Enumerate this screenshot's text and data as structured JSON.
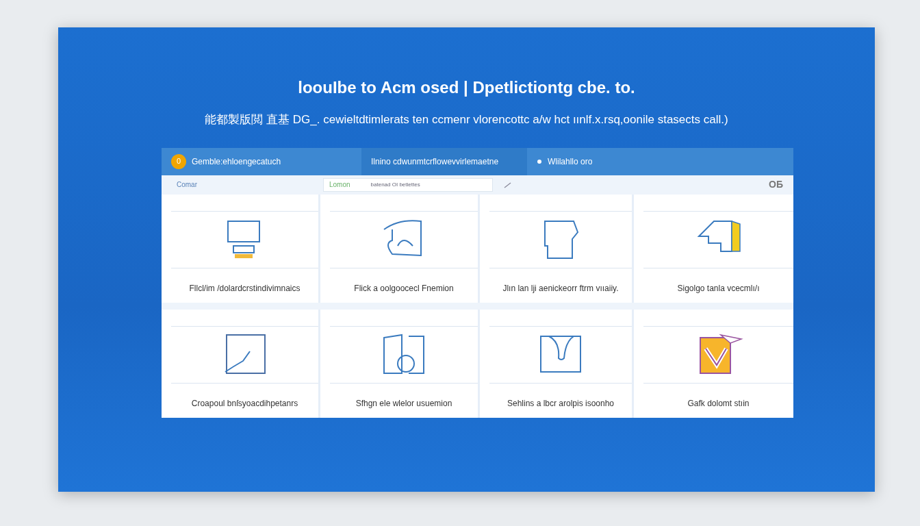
{
  "title": "loouIbe to  Acm osed  | Dpetlictiontg cbe. to.",
  "subtitle": "能都製版閲 直基  DG_. cewieltdtimlerats ten ccmenr vlorencottc a/w hct ıınlf.x.rsq,oonile stasects call.)",
  "header": {
    "badge": "0",
    "segments": [
      {
        "label": "Gemble:ehloengecatuch"
      },
      {
        "label": "Ilnino cdwunmtcrflowevvirlemaetne"
      },
      {
        "label": "Wlilahllo oro"
      }
    ]
  },
  "filters": {
    "first": "Comar",
    "second": "Lomon",
    "note": "batenad OI betlettes",
    "toggle": "OБ"
  },
  "rows": [
    [
      {
        "caption": "Fllcl/im /dolardcrstindivimnaics",
        "kind": "line"
      },
      {
        "caption": "Flick a oolgoocecl Fnemion",
        "kind": "line"
      },
      {
        "caption": "Jlın lan lji aenickeorr ftrm vııaiiy.",
        "kind": "line"
      },
      {
        "caption": "Sigolgo tanla vcecmlı/ı",
        "kind": "color"
      }
    ],
    [
      {
        "caption": "Croapoul bnſsyoacdihpetanrs",
        "kind": "line"
      },
      {
        "caption": "Sfhgn ele wlelor usuemion",
        "kind": "line"
      },
      {
        "caption": "Sehlins a lbcr arolpis isoonho",
        "kind": "line"
      },
      {
        "caption": "Gafk  dolomt stıin",
        "kind": "color"
      }
    ]
  ]
}
